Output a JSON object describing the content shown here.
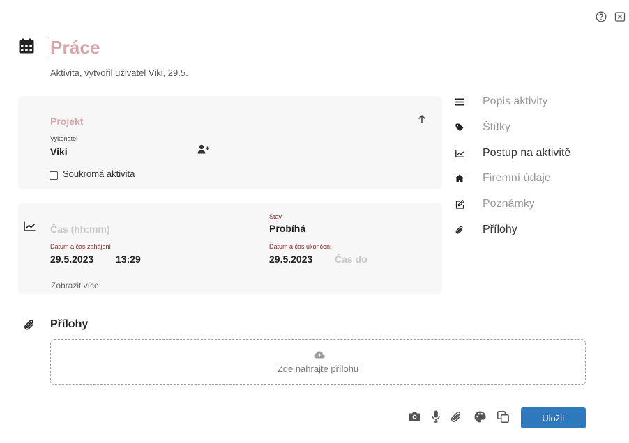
{
  "header": {
    "title": "Práce",
    "subtitle": "Aktivita, vytvořil uživatel Viki, 29.5."
  },
  "top_icons": [
    "help-icon",
    "close-icon"
  ],
  "project_card": {
    "project_placeholder": "Projekt",
    "assignee_label": "Vykonatel",
    "assignee_value": "Viki",
    "private_label": "Soukromá aktivita",
    "private_checked": false
  },
  "progress_card": {
    "time_placeholder": "Čas (hh:mm)",
    "status_label": "Stav",
    "status_value": "Probíhá",
    "start_label": "Datum a čas zahájení",
    "start_date": "29.5.2023",
    "start_time": "13:29",
    "end_label": "Datum a čas ukončení",
    "end_date": "29.5.2023",
    "end_time_placeholder": "Čas do",
    "show_more": "Zobrazit více"
  },
  "sidebar": {
    "items": [
      {
        "label": "Popis aktivity",
        "icon": "lines-icon",
        "active": false
      },
      {
        "label": "Štítky",
        "icon": "tag-icon",
        "active": false
      },
      {
        "label": "Postup na aktivitě",
        "icon": "chart-line-icon",
        "active": true
      },
      {
        "label": "Firemní údaje",
        "icon": "home-icon",
        "active": false
      },
      {
        "label": "Poznámky",
        "icon": "edit-icon",
        "active": false
      },
      {
        "label": "Přílohy",
        "icon": "paperclip-icon",
        "active": true
      }
    ]
  },
  "attachments": {
    "heading": "Přílohy",
    "dropzone_text": "Zde nahrajte přílohu"
  },
  "footer": {
    "tools": [
      "camera-icon",
      "microphone-icon",
      "paperclip-icon",
      "palette-icon",
      "copy-icon"
    ],
    "save_label": "Uložit"
  },
  "colors": {
    "accent": "#2e78bd",
    "placeholder_pink": "#d8a7ab",
    "label_red": "#8b1f1f",
    "card_bg": "#f7f7f7"
  }
}
